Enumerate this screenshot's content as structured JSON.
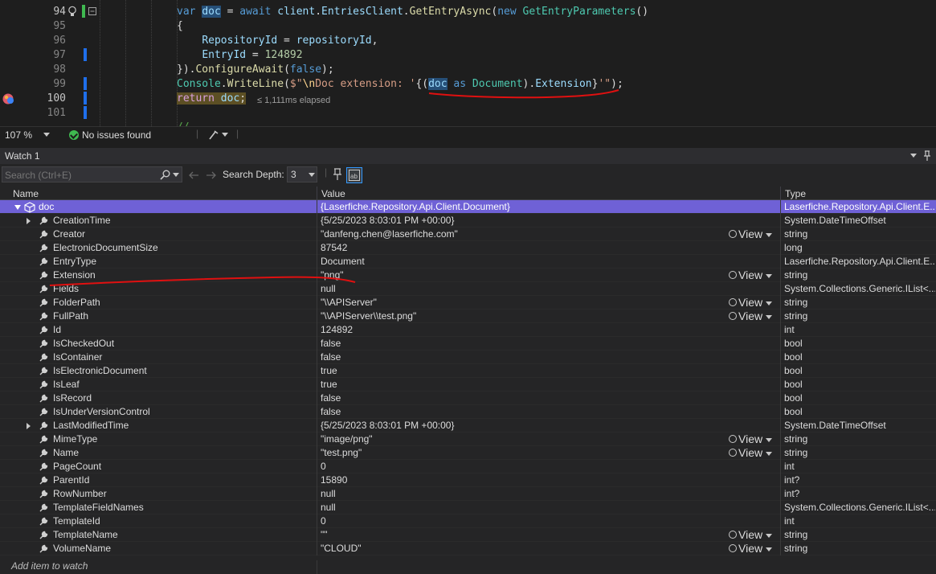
{
  "editor": {
    "lines": [
      {
        "num": "94"
      },
      {
        "num": "95"
      },
      {
        "num": "96"
      },
      {
        "num": "97"
      },
      {
        "num": "98"
      },
      {
        "num": "99"
      },
      {
        "num": "100"
      },
      {
        "num": "101"
      }
    ],
    "elapsed": "≤ 1,111ms elapsed"
  },
  "status": {
    "zoom": "107 %",
    "issues": "No issues found"
  },
  "watch": {
    "title": "Watch 1",
    "search_placeholder": "Search (Ctrl+E)",
    "search_depth_label": "Search Depth:",
    "search_depth_value": "3",
    "columns": {
      "name": "Name",
      "value": "Value",
      "type": "Type"
    },
    "view_label": "View",
    "add_item": "Add item to watch",
    "root": {
      "name": "doc",
      "value": "{Laserfiche.Repository.Api.Client.Document}",
      "type": "Laserfiche.Repository.Api.Client.E..."
    },
    "rows": [
      {
        "name": "CreationTime",
        "value": "{5/25/2023 8:03:01 PM +00:00}",
        "type": "System.DateTimeOffset",
        "expandable": true,
        "view": false
      },
      {
        "name": "Creator",
        "value": "\"danfeng.chen@laserfiche.com\"",
        "type": "string",
        "expandable": false,
        "view": true
      },
      {
        "name": "ElectronicDocumentSize",
        "value": "87542",
        "type": "long",
        "expandable": false,
        "view": false
      },
      {
        "name": "EntryType",
        "value": "Document",
        "type": "Laserfiche.Repository.Api.Client.E...",
        "expandable": false,
        "view": false
      },
      {
        "name": "Extension",
        "value": "\"png\"",
        "type": "string",
        "expandable": false,
        "view": true
      },
      {
        "name": "Fields",
        "value": "null",
        "type": "System.Collections.Generic.IList<...",
        "expandable": false,
        "view": false
      },
      {
        "name": "FolderPath",
        "value": "\"\\\\APIServer\"",
        "type": "string",
        "expandable": false,
        "view": true
      },
      {
        "name": "FullPath",
        "value": "\"\\\\APIServer\\\\test.png\"",
        "type": "string",
        "expandable": false,
        "view": true
      },
      {
        "name": "Id",
        "value": "124892",
        "type": "int",
        "expandable": false,
        "view": false
      },
      {
        "name": "IsCheckedOut",
        "value": "false",
        "type": "bool",
        "expandable": false,
        "view": false
      },
      {
        "name": "IsContainer",
        "value": "false",
        "type": "bool",
        "expandable": false,
        "view": false
      },
      {
        "name": "IsElectronicDocument",
        "value": "true",
        "type": "bool",
        "expandable": false,
        "view": false
      },
      {
        "name": "IsLeaf",
        "value": "true",
        "type": "bool",
        "expandable": false,
        "view": false
      },
      {
        "name": "IsRecord",
        "value": "false",
        "type": "bool",
        "expandable": false,
        "view": false
      },
      {
        "name": "IsUnderVersionControl",
        "value": "false",
        "type": "bool",
        "expandable": false,
        "view": false
      },
      {
        "name": "LastModifiedTime",
        "value": "{5/25/2023 8:03:01 PM +00:00}",
        "type": "System.DateTimeOffset",
        "expandable": true,
        "view": false
      },
      {
        "name": "MimeType",
        "value": "\"image/png\"",
        "type": "string",
        "expandable": false,
        "view": true
      },
      {
        "name": "Name",
        "value": "\"test.png\"",
        "type": "string",
        "expandable": false,
        "view": true
      },
      {
        "name": "PageCount",
        "value": "0",
        "type": "int",
        "expandable": false,
        "view": false
      },
      {
        "name": "ParentId",
        "value": "15890",
        "type": "int?",
        "expandable": false,
        "view": false
      },
      {
        "name": "RowNumber",
        "value": "null",
        "type": "int?",
        "expandable": false,
        "view": false
      },
      {
        "name": "TemplateFieldNames",
        "value": "null",
        "type": "System.Collections.Generic.IList<...",
        "expandable": false,
        "view": false
      },
      {
        "name": "TemplateId",
        "value": "0",
        "type": "int",
        "expandable": false,
        "view": false
      },
      {
        "name": "TemplateName",
        "value": "\"\"",
        "type": "string",
        "expandable": false,
        "view": true
      },
      {
        "name": "VolumeName",
        "value": "\"CLOUD\"",
        "type": "string",
        "expandable": false,
        "view": true
      }
    ]
  }
}
